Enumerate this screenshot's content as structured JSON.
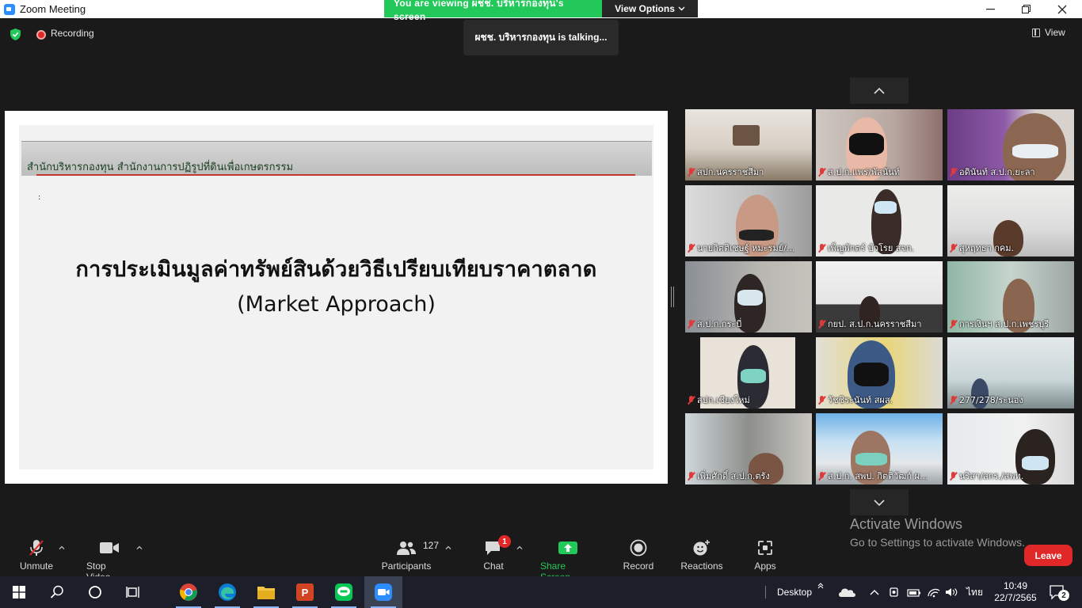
{
  "window": {
    "title": "Zoom Meeting"
  },
  "banner": {
    "viewing": "You are viewing ผชช. บริหารกองทุน's screen",
    "view_options": "View Options"
  },
  "meeting": {
    "recording_label": "Recording",
    "talking": "ผชช. บริหารกองทุน is talking...",
    "view_label": "View"
  },
  "slide": {
    "header": "สำนักบริหารกองทุน สำนักงานการปฏิรูปที่ดินเพื่อเกษตรกรรม",
    "colon": ":",
    "title": "การประเมินมูลค่าทรัพย์สินด้วยวิธีเปรียบเทียบราคาตลาด",
    "subtitle": "(Market Approach)"
  },
  "participants_tiles": [
    {
      "name": "สปก.นครราชสีมา"
    },
    {
      "name": "ส.ป.ก.แพร่/พัสนันท์"
    },
    {
      "name": "อดินันท์ ส.ป.ก.ยะลา"
    },
    {
      "name": "นายกิตติเชษฐ์ หมะรมย์/..."
    },
    {
      "name": "เพ็ญพักตร์ บัวโรย สจก."
    },
    {
      "name": "สุหฤทธา กคม."
    },
    {
      "name": "ส.ป.ก.กระบี่"
    },
    {
      "name": "กยป. ส.ป.ก.นครราชสีมา"
    },
    {
      "name": "การเงินฯ ส.ป.ก.เพชรบุรี"
    },
    {
      "name": "สปก.เชียงใหม่"
    },
    {
      "name": "วัชชิระนันท์ สผส."
    },
    {
      "name": "277/278/ระนอง"
    },
    {
      "name": "เพิ่มศักดิ์ ส.ป.ก.ตรัง"
    },
    {
      "name": "ส.ป.ก. สพป. กิตติวัฒก์ ผ..."
    },
    {
      "name": "นริสา/สกร./สพท."
    }
  ],
  "watermark": {
    "line1": "Activate Windows",
    "line2": "Go to Settings to activate Windows."
  },
  "toolbar": {
    "unmute": "Unmute",
    "stop_video": "Stop Video",
    "participants": "Participants",
    "participant_count": "127",
    "chat": "Chat",
    "chat_badge": "1",
    "share_screen": "Share Screen",
    "record": "Record",
    "reactions": "Reactions",
    "apps": "Apps",
    "leave": "Leave"
  },
  "taskbar": {
    "desktop": "Desktop",
    "lang": "ไทย",
    "time": "10:49",
    "date": "22/7/2565",
    "notif_count": "2"
  },
  "colors": {
    "share_green": "#23c85a",
    "leave_red": "#e02828",
    "zoom_blue": "#2d8cff"
  }
}
